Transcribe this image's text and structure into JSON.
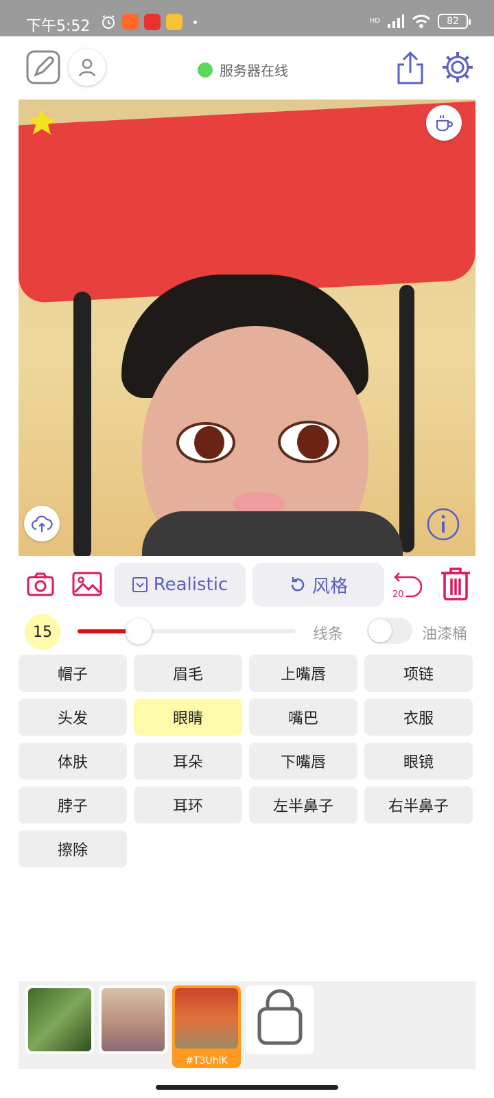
{
  "status_bar": {
    "time": "下午5:52",
    "battery": "82",
    "network_label": "HD"
  },
  "header": {
    "server_status": "服务器在线"
  },
  "tools": {
    "style_mode": "Realistic",
    "style_button": "风格",
    "undo_count": "20"
  },
  "brush": {
    "size": "15",
    "slider_level": 0.28,
    "line_label": "线条",
    "bucket_label": "油漆桶",
    "bucket_enabled": false
  },
  "parts": [
    {
      "label": "帽子",
      "selected": false
    },
    {
      "label": "眉毛",
      "selected": false
    },
    {
      "label": "上嘴唇",
      "selected": false
    },
    {
      "label": "项链",
      "selected": false
    },
    {
      "label": "头发",
      "selected": false
    },
    {
      "label": "眼睛",
      "selected": true
    },
    {
      "label": "嘴巴",
      "selected": false
    },
    {
      "label": "衣服",
      "selected": false
    },
    {
      "label": "体肤",
      "selected": false
    },
    {
      "label": "耳朵",
      "selected": false
    },
    {
      "label": "下嘴唇",
      "selected": false
    },
    {
      "label": "眼镜",
      "selected": false
    },
    {
      "label": "脖子",
      "selected": false
    },
    {
      "label": "耳环",
      "selected": false
    },
    {
      "label": "左半鼻子",
      "selected": false
    },
    {
      "label": "右半鼻子",
      "selected": false
    },
    {
      "label": "擦除",
      "selected": false
    }
  ],
  "gallery": {
    "selected_caption": "#T3UhiK"
  },
  "colors": {
    "accent": "#5a5fc7",
    "danger": "#e0185a",
    "highlight": "#fffbaa",
    "selected_thumb": "#ff9a1f",
    "server_online": "#5cd65c"
  }
}
